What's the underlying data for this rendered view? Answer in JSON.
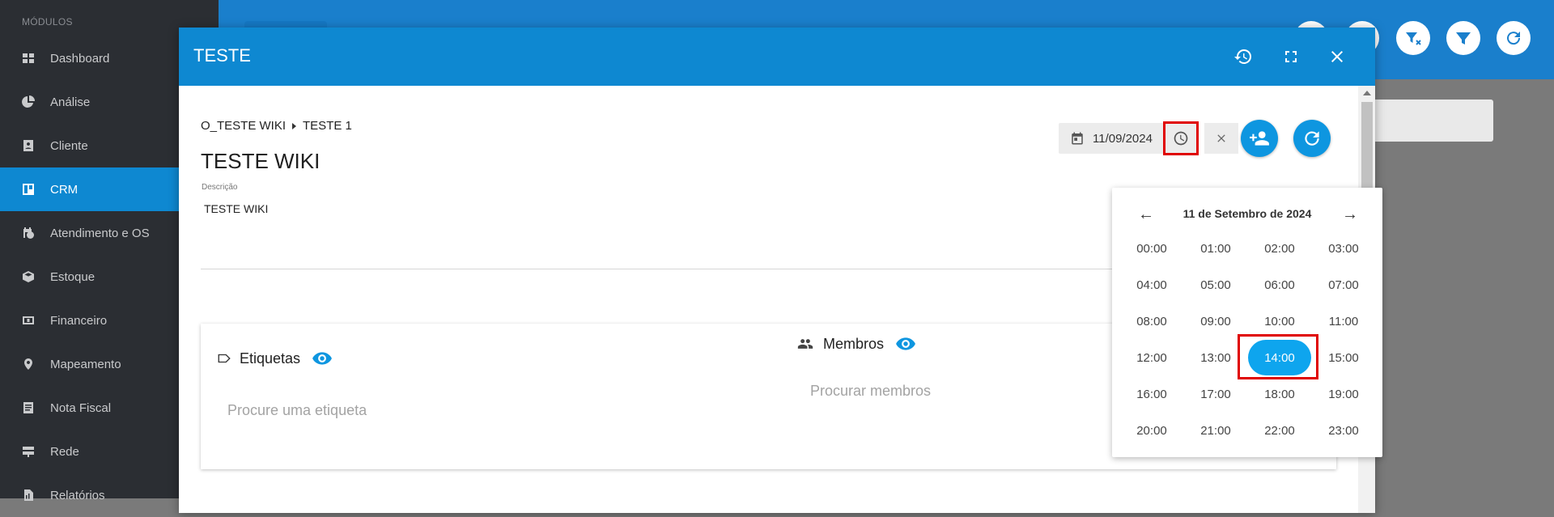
{
  "sidebar": {
    "section_label": "MÓDULOS",
    "items": [
      {
        "label": "Dashboard",
        "icon": "grid-icon"
      },
      {
        "label": "Análise",
        "icon": "pie-chart-icon"
      },
      {
        "label": "Cliente",
        "icon": "contact-card-icon"
      },
      {
        "label": "CRM",
        "icon": "kanban-icon",
        "active": true
      },
      {
        "label": "Atendimento e OS",
        "icon": "calendar-clock-icon"
      },
      {
        "label": "Estoque",
        "icon": "box-icon"
      },
      {
        "label": "Financeiro",
        "icon": "money-icon"
      },
      {
        "label": "Mapeamento",
        "icon": "map-pin-icon"
      },
      {
        "label": "Nota Fiscal",
        "icon": "document-icon"
      },
      {
        "label": "Rede",
        "icon": "network-icon"
      },
      {
        "label": "Relatórios",
        "icon": "report-icon"
      }
    ]
  },
  "modal": {
    "title": "TESTE",
    "breadcrumb": [
      "O_TESTE WIKI",
      "TESTE 1"
    ],
    "card_title": "TESTE WIKI",
    "description_label": "Descrição",
    "description_value": "TESTE WIKI",
    "date_value": "11/09/2024",
    "labels_section": {
      "title": "Etiquetas",
      "search_placeholder": "Procure uma etiqueta"
    },
    "members_section": {
      "title": "Membros",
      "search_placeholder": "Procurar membros"
    }
  },
  "time_picker": {
    "prev": "←",
    "next": "→",
    "date_title": "11 de Setembro de 2024",
    "hours": [
      "00:00",
      "01:00",
      "02:00",
      "03:00",
      "04:00",
      "05:00",
      "06:00",
      "07:00",
      "08:00",
      "09:00",
      "10:00",
      "11:00",
      "12:00",
      "13:00",
      "14:00",
      "15:00",
      "16:00",
      "17:00",
      "18:00",
      "19:00",
      "20:00",
      "21:00",
      "22:00",
      "23:00"
    ],
    "selected": "14:00"
  },
  "colors": {
    "primary": "#0e88d1",
    "accent": "#0ea5ee",
    "highlight": "#e00000",
    "sidebar_bg": "#2b2e33"
  }
}
